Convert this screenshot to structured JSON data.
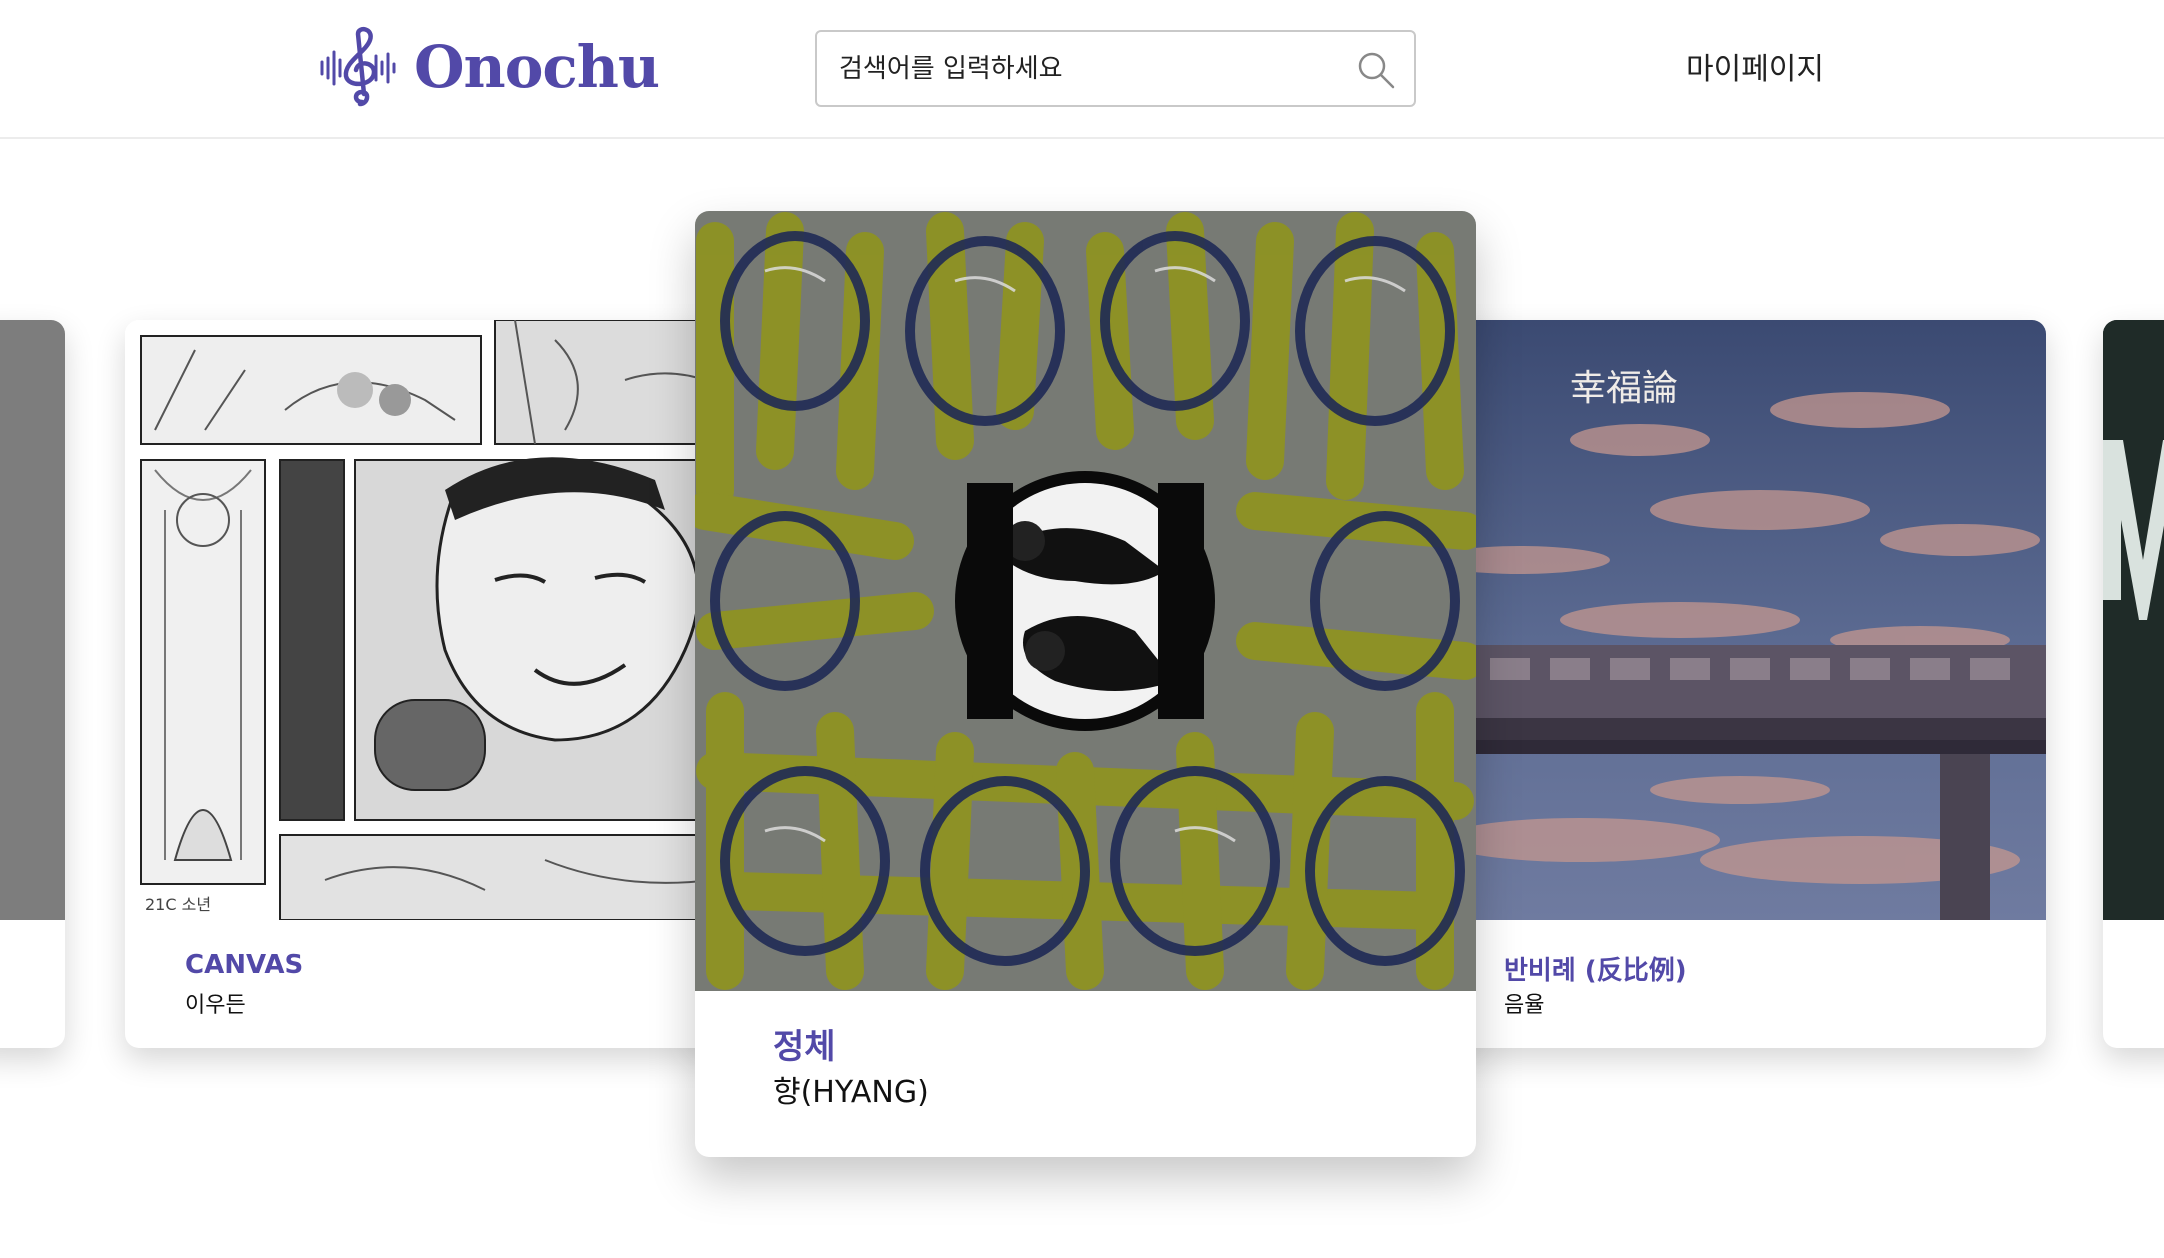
{
  "app": {
    "name": "Onochu"
  },
  "header": {
    "logo_text": "Onochu",
    "search": {
      "placeholder": "검색어를 입력하세요",
      "value": ""
    },
    "mypage_label": "마이페이지"
  },
  "carousel": {
    "cards": [
      {
        "title": "",
        "artist": ""
      },
      {
        "title": "CANVAS",
        "artist": "이우든",
        "cover_caption": "21C 소년"
      },
      {
        "title": "정체",
        "artist": "향(HYANG)"
      },
      {
        "title": "반비례 (反比例)",
        "artist": "음율",
        "cover_text": "幸福論"
      },
      {
        "title": "",
        "artist": ""
      }
    ]
  },
  "colors": {
    "accent": "#5249a8",
    "text": "#111111",
    "border": "#c9c9c9"
  },
  "icons": {
    "logo": "treble-clef-waveform-icon",
    "search": "search-icon"
  }
}
